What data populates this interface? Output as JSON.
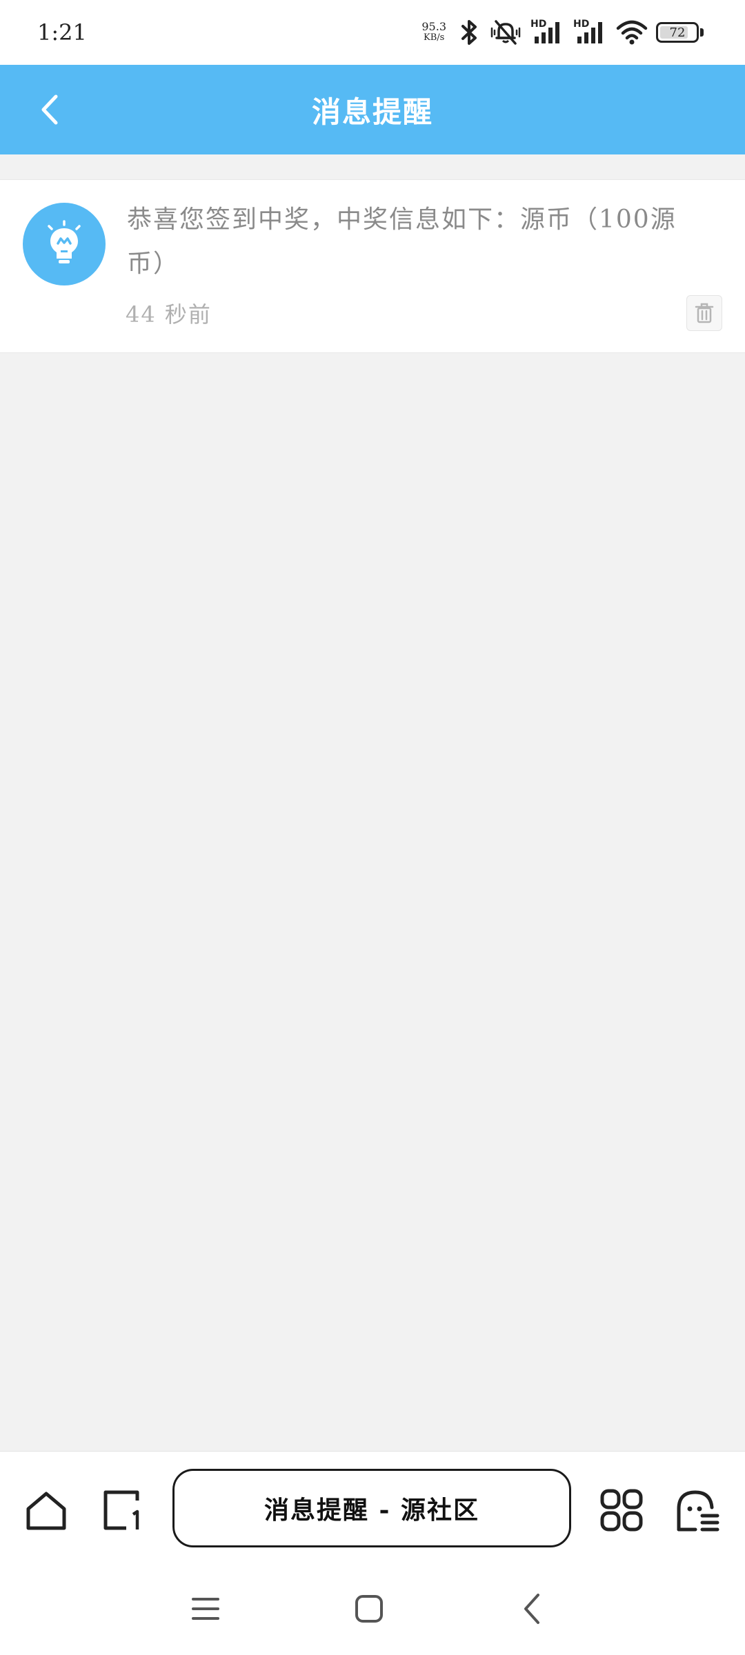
{
  "status_bar": {
    "time": "1:21",
    "net_speed_value": "95.3",
    "net_speed_unit": "KB/s",
    "hd_label_1": "HD",
    "hd_label_2": "HD",
    "battery_level": "72",
    "icons": [
      "bluetooth-icon",
      "muted-vibrate-icon",
      "signal-icon",
      "signal-icon",
      "wifi-icon",
      "battery-icon"
    ]
  },
  "header": {
    "title": "消息提醒",
    "back_icon": "chevron-left-icon"
  },
  "notification": {
    "message": "恭喜您签到中奖，中奖信息如下：源币（100源币）",
    "time": "44 秒前",
    "avatar_icon": "lightbulb-icon",
    "delete_icon": "trash-icon"
  },
  "browser_toolbar": {
    "address_text": "消息提醒 - 源社区",
    "icons": [
      "home-icon",
      "tabs-icon",
      "apps-grid-icon",
      "ghost-menu-icon"
    ]
  },
  "nav_bar": {
    "icons": [
      "menu-icon",
      "home-square-icon",
      "back-icon"
    ]
  },
  "colors": {
    "accent": "#56baf4",
    "background": "#f2f2f2",
    "card": "#ffffff",
    "text_muted": "#8a8a8a"
  }
}
